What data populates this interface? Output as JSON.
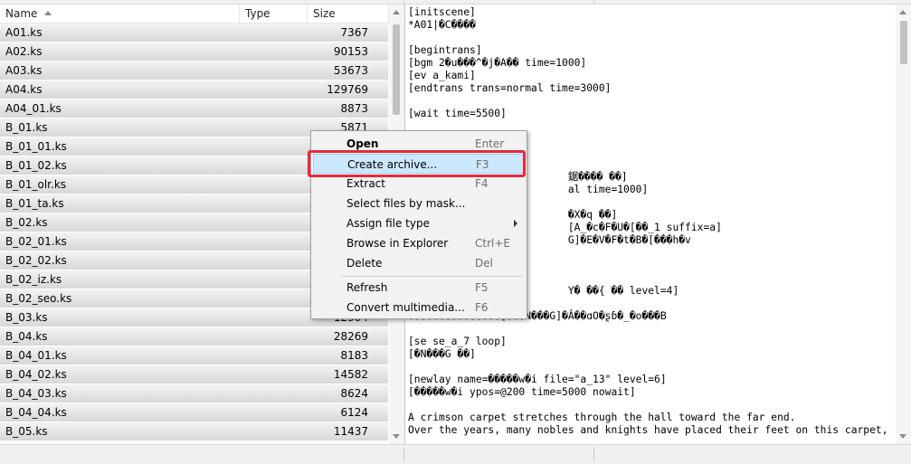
{
  "columns": {
    "name": "Name",
    "type": "Type",
    "size": "Size"
  },
  "files": [
    {
      "name": "A01.ks",
      "size": "7367"
    },
    {
      "name": "A02.ks",
      "size": "90153"
    },
    {
      "name": "A03.ks",
      "size": "53673"
    },
    {
      "name": "A04.ks",
      "size": "129769"
    },
    {
      "name": "A04_01.ks",
      "size": "8873"
    },
    {
      "name": "B_01.ks",
      "size": "5871"
    },
    {
      "name": "B_01_01.ks",
      "size": ""
    },
    {
      "name": "B_01_02.ks",
      "size": ""
    },
    {
      "name": "B_01_olr.ks",
      "size": ""
    },
    {
      "name": "B_01_ta.ks",
      "size": ""
    },
    {
      "name": "B_02.ks",
      "size": ""
    },
    {
      "name": "B_02_01.ks",
      "size": ""
    },
    {
      "name": "B_02_02.ks",
      "size": ""
    },
    {
      "name": "B_02_iz.ks",
      "size": ""
    },
    {
      "name": "B_02_seo.ks",
      "size": ""
    },
    {
      "name": "B_03.ks",
      "size": "12304"
    },
    {
      "name": "B_04.ks",
      "size": "28269"
    },
    {
      "name": "B_04_01.ks",
      "size": "8183"
    },
    {
      "name": "B_04_02.ks",
      "size": "14582"
    },
    {
      "name": "B_04_03.ks",
      "size": "8624"
    },
    {
      "name": "B_04_04.ks",
      "size": "6124"
    },
    {
      "name": "B_05.ks",
      "size": "11437"
    }
  ],
  "editor_lines": [
    "[initscene]",
    "*A01|�C����",
    "",
    "[begintrans]",
    "[bgm 2�u���^�j�A�� time=1000]",
    "[ev a_kami]",
    "[endtrans trans=normal time=3000]",
    "",
    "[wait time=5500]",
    "",
    "",
    "",
    "",
    "                          鋸���� ��]",
    "                          al time=1000]",
    "",
    "                          �X�q ��]",
    "                          [A_�c�F�U�[��_1 suffix=a]",
    "                          G]�E�V�F�t�B�[���h�v",
    "",
    "",
    "",
    "                          Y� ��{ �� level=4]",
    "",
    "���������������[���N���G]�Â��ɑO�ʂɓ�_�o���B",
    "",
    "[se se_a_7 loop]",
    "[�N���G ��]",
    "",
    "[newlay name=�����w�i file=\"a_13\" level=6]",
    "[�����w�i ypos=@200 time=5000 nowait]",
    "",
    "A crimson carpet stretches through the hall toward the far end.",
    "Over the years, many nobles and knights have placed their feet on this carpet,"
  ],
  "context_menu": {
    "items": [
      {
        "label": "Open",
        "shortcut": "Enter"
      },
      {
        "label": "Create archive...",
        "shortcut": "F3"
      },
      {
        "label": "Extract",
        "shortcut": "F4"
      },
      {
        "label": "Select files by mask...",
        "shortcut": ""
      },
      {
        "label": "Assign file type",
        "shortcut": ""
      },
      {
        "label": "Browse in Explorer",
        "shortcut": "Ctrl+E"
      },
      {
        "label": "Delete",
        "shortcut": "Del"
      },
      {
        "label": "Refresh",
        "shortcut": "F5"
      },
      {
        "label": "Convert multimedia...",
        "shortcut": "F6"
      }
    ]
  },
  "colors": {
    "highlight": "#cce8ff",
    "annotation_box": "#e8283c"
  }
}
